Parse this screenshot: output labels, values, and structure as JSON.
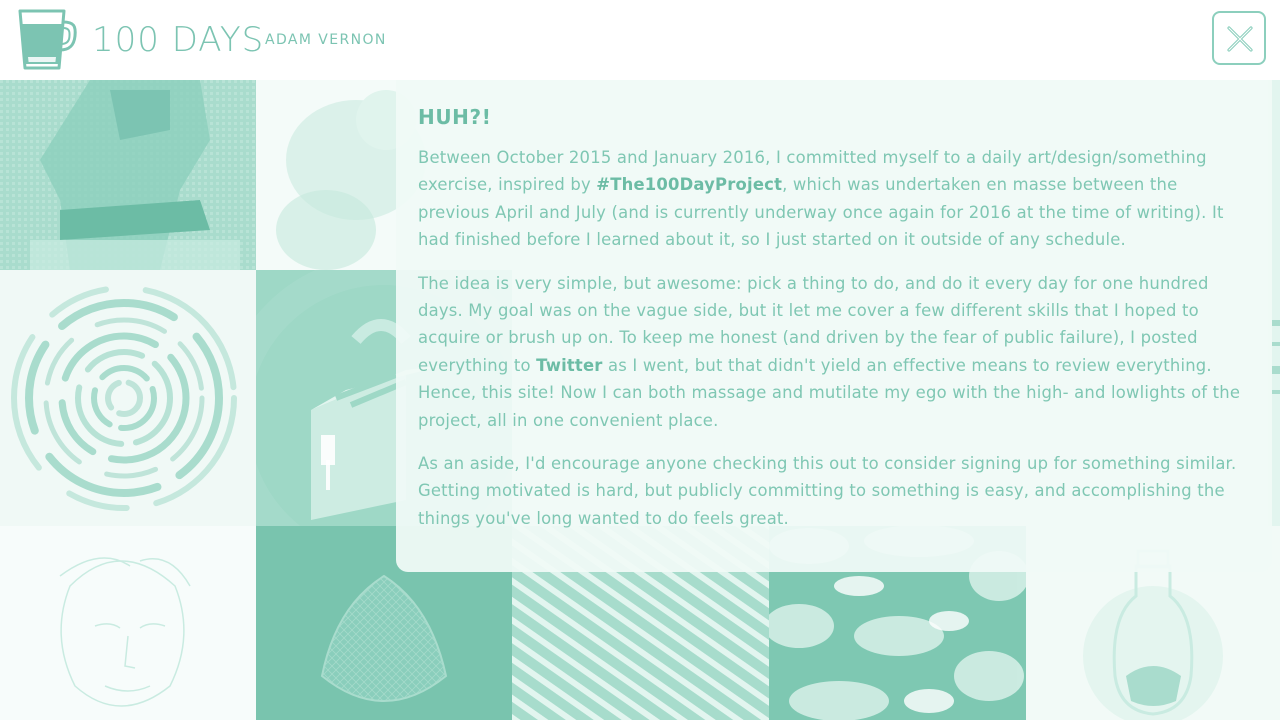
{
  "header": {
    "title": "100 DAYS",
    "author": "ADAM VERNON",
    "logo_icon": "coffee-cup-icon",
    "close_icon": "close-icon"
  },
  "colors": {
    "accent": "#7cc4b2",
    "accent_dark": "#6cbca5",
    "tile_light": "#a9dccd",
    "tile_dark": "#79c4ae",
    "modal_bg": "#f0faf6"
  },
  "modal": {
    "heading": "HUH?!",
    "p1": {
      "pre": "Between October 2015 and January 2016, I committed myself to a daily art/design/something exercise, inspired by ",
      "link": "#The100DayProject",
      "post": ", which was undertaken en masse between the previous April and July (and is currently underway once again for 2016 at the time of writing). It had finished before I learned about it, so I just started on it outside of any schedule."
    },
    "p2": {
      "pre": "The idea is very simple, but awesome: pick a thing to do, and do it every day for one hundred days. My goal was on the vague side, but it let me cover a few different skills that I hoped to acquire or brush up on. To keep me honest (and driven by the fear of public failure), I posted everything to ",
      "link": "Twitter",
      "post": " as I went, but that didn't yield an effective means to review everything. Hence, this site! Now I can both massage and mutilate my ego with the high- and lowlights of the project, all in one convenient place."
    },
    "p3": "As an aside, I'd encourage anyone checking this out to consider signing up for something similar. Getting motivated is hard, but publicly committing to something is easy, and accomplishing the things you've long wanted to do feels great."
  },
  "gallery": {
    "tiles": [
      {
        "name": "gallery-tile-pixel-figure",
        "icon": "pixel-figure-image"
      },
      {
        "name": "gallery-tile-watercolor",
        "icon": "watercolor-image"
      },
      {
        "name": "gallery-tile-spiral",
        "icon": "spiral-rings-image"
      },
      {
        "name": "gallery-tile-toaster",
        "icon": "toaster-image"
      },
      {
        "name": "gallery-tile-sketch-face",
        "icon": "sketch-face-image"
      },
      {
        "name": "gallery-tile-reuleaux",
        "icon": "reuleaux-triangle-image"
      },
      {
        "name": "gallery-tile-stripes",
        "icon": "diagonal-stripes-image"
      },
      {
        "name": "gallery-tile-clouds",
        "icon": "clouds-image"
      },
      {
        "name": "gallery-tile-bottle",
        "icon": "bottle-image"
      }
    ]
  }
}
